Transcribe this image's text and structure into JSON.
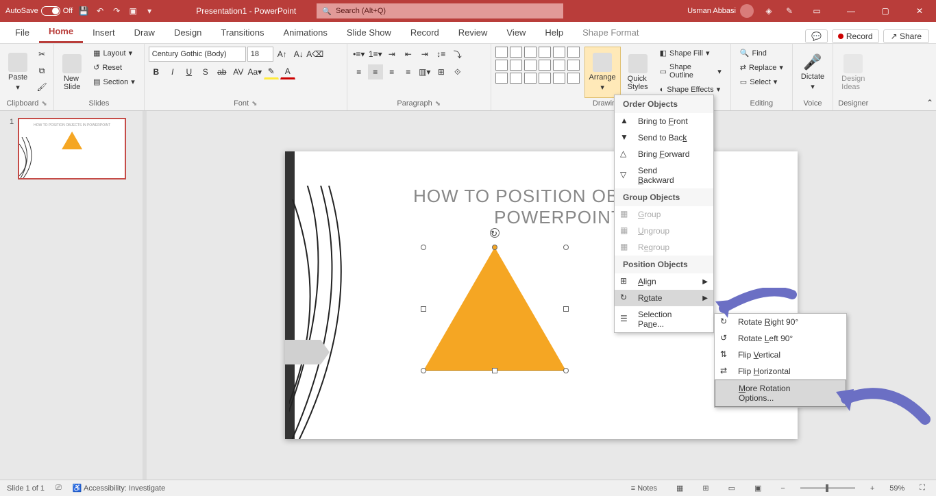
{
  "titlebar": {
    "autosave_label": "AutoSave",
    "autosave_state": "Off",
    "doc_title": "Presentation1 - PowerPoint",
    "search_placeholder": "Search (Alt+Q)",
    "user": "Usman Abbasi"
  },
  "tabs": {
    "file": "File",
    "home": "Home",
    "insert": "Insert",
    "draw": "Draw",
    "design": "Design",
    "transitions": "Transitions",
    "animations": "Animations",
    "slideshow": "Slide Show",
    "record_tab": "Record",
    "review": "Review",
    "view": "View",
    "help": "Help",
    "shape_format": "Shape Format",
    "record_btn": "Record",
    "share": "Share"
  },
  "ribbon": {
    "clipboard": {
      "paste": "Paste",
      "label": "Clipboard"
    },
    "slides": {
      "new_slide": "New\nSlide",
      "layout": "Layout",
      "reset": "Reset",
      "section": "Section",
      "label": "Slides"
    },
    "font": {
      "name": "Century Gothic (Body)",
      "size": "18",
      "label": "Font"
    },
    "paragraph": {
      "label": "Paragraph"
    },
    "drawing": {
      "arrange": "Arrange",
      "quick_styles": "Quick\nStyles",
      "shape_fill": "Shape Fill",
      "shape_outline": "Shape Outline",
      "shape_effects": "Shape Effects",
      "label": "Drawing"
    },
    "editing": {
      "find": "Find",
      "replace": "Replace",
      "select": "Select",
      "label": "Editing"
    },
    "voice": {
      "dictate": "Dictate",
      "label": "Voice"
    },
    "designer": {
      "design_ideas": "Design\nIdeas",
      "label": "Designer"
    }
  },
  "arrange_menu": {
    "order_header": "Order Objects",
    "bring_front": "Bring to Front",
    "send_back": "Send to Back",
    "bring_forward": "Bring Forward",
    "send_backward": "Send Backward",
    "group_header": "Group Objects",
    "group": "Group",
    "ungroup": "Ungroup",
    "regroup": "Regroup",
    "position_header": "Position Objects",
    "align": "Align",
    "rotate": "Rotate",
    "selection_pane": "Selection Pane..."
  },
  "rotate_menu": {
    "rotate_right": "Rotate Right 90°",
    "rotate_left": "Rotate Left 90°",
    "flip_vertical": "Flip Vertical",
    "flip_horizontal": "Flip Horizontal",
    "more": "More Rotation Options..."
  },
  "slide": {
    "title": "HOW TO POSITION OBJECTS  IN POWERPOINT",
    "thumb_title": "HOW TO POSITION OBJECTS IN POWERPOINT"
  },
  "thumbs": {
    "num1": "1"
  },
  "status": {
    "slide_info": "Slide 1 of 1",
    "accessibility": "Accessibility: Investigate",
    "notes": "Notes",
    "zoom": "59%"
  }
}
